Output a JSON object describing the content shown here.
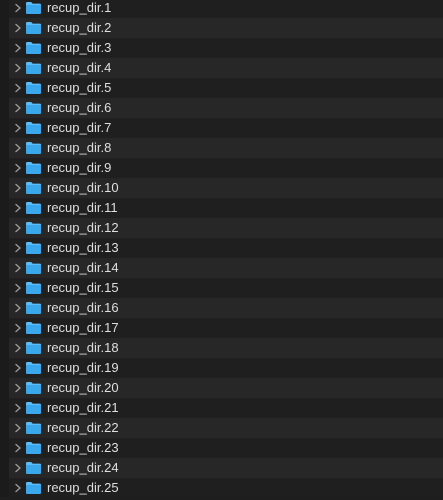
{
  "icons": {
    "disclosure": "chevron-right-icon",
    "folder": "folder-icon"
  },
  "colors": {
    "folder_blue": "#3aa8ea",
    "folder_tab": "#5cbcf4",
    "row_alt": "#272727",
    "row_base": "#1f1f1f",
    "text": "#dfdfdf"
  },
  "folders": [
    {
      "label": "recup_dir.1"
    },
    {
      "label": "recup_dir.2"
    },
    {
      "label": "recup_dir.3"
    },
    {
      "label": "recup_dir.4"
    },
    {
      "label": "recup_dir.5"
    },
    {
      "label": "recup_dir.6"
    },
    {
      "label": "recup_dir.7"
    },
    {
      "label": "recup_dir.8"
    },
    {
      "label": "recup_dir.9"
    },
    {
      "label": "recup_dir.10"
    },
    {
      "label": "recup_dir.11"
    },
    {
      "label": "recup_dir.12"
    },
    {
      "label": "recup_dir.13"
    },
    {
      "label": "recup_dir.14"
    },
    {
      "label": "recup_dir.15"
    },
    {
      "label": "recup_dir.16"
    },
    {
      "label": "recup_dir.17"
    },
    {
      "label": "recup_dir.18"
    },
    {
      "label": "recup_dir.19"
    },
    {
      "label": "recup_dir.20"
    },
    {
      "label": "recup_dir.21"
    },
    {
      "label": "recup_dir.22"
    },
    {
      "label": "recup_dir.23"
    },
    {
      "label": "recup_dir.24"
    },
    {
      "label": "recup_dir.25"
    }
  ]
}
